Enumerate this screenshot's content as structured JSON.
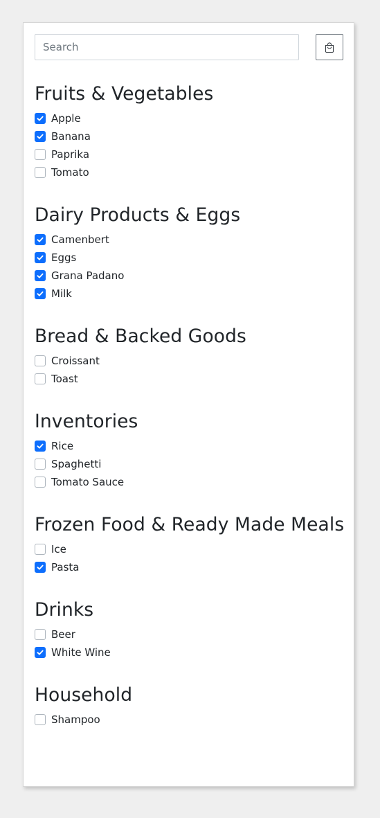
{
  "search": {
    "placeholder": "Search",
    "value": ""
  },
  "toolbar": {
    "bag_icon": "shopping-bag-icon"
  },
  "colors": {
    "accent": "#0d6efd",
    "background": "#efefef",
    "card": "#ffffff"
  },
  "groups": [
    {
      "title": "Fruits & Vegetables",
      "items": [
        {
          "label": "Apple",
          "checked": true
        },
        {
          "label": "Banana",
          "checked": true
        },
        {
          "label": "Paprika",
          "checked": false
        },
        {
          "label": "Tomato",
          "checked": false
        }
      ]
    },
    {
      "title": "Dairy Products & Eggs",
      "items": [
        {
          "label": "Camenbert",
          "checked": true
        },
        {
          "label": "Eggs",
          "checked": true
        },
        {
          "label": "Grana Padano",
          "checked": true
        },
        {
          "label": "Milk",
          "checked": true
        }
      ]
    },
    {
      "title": "Bread & Backed Goods",
      "items": [
        {
          "label": "Croissant",
          "checked": false
        },
        {
          "label": "Toast",
          "checked": false
        }
      ]
    },
    {
      "title": "Inventories",
      "items": [
        {
          "label": "Rice",
          "checked": true
        },
        {
          "label": "Spaghetti",
          "checked": false
        },
        {
          "label": "Tomato Sauce",
          "checked": false
        }
      ]
    },
    {
      "title": "Frozen Food & Ready Made Meals",
      "items": [
        {
          "label": "Ice",
          "checked": false
        },
        {
          "label": "Pasta",
          "checked": true
        }
      ]
    },
    {
      "title": "Drinks",
      "items": [
        {
          "label": "Beer",
          "checked": false
        },
        {
          "label": "White Wine",
          "checked": true
        }
      ]
    },
    {
      "title": "Household",
      "items": [
        {
          "label": "Shampoo",
          "checked": false
        }
      ]
    }
  ]
}
